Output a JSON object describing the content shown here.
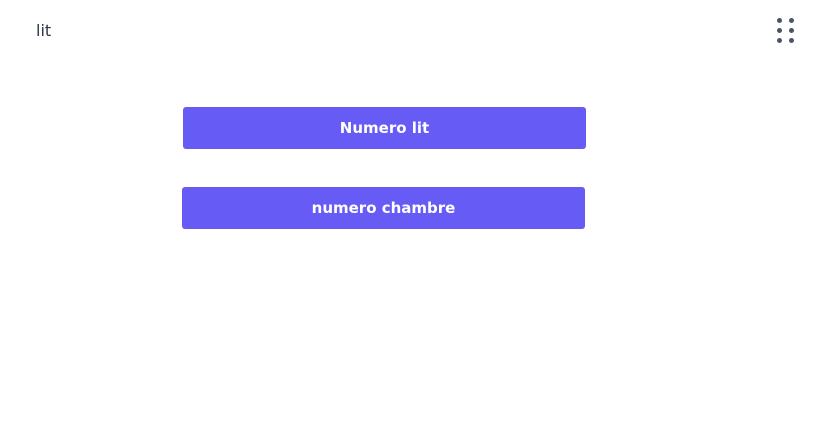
{
  "header": {
    "title": "lit",
    "menu_icon": "dots-grid-icon"
  },
  "actions": [
    {
      "label": "Numero lit"
    },
    {
      "label": "numero chambre"
    }
  ],
  "colors": {
    "button_background": "#665cf5",
    "button_text": "#ffffff",
    "title_text": "#2d3748",
    "icon": "#4a5568",
    "page_background": "#ffffff"
  }
}
